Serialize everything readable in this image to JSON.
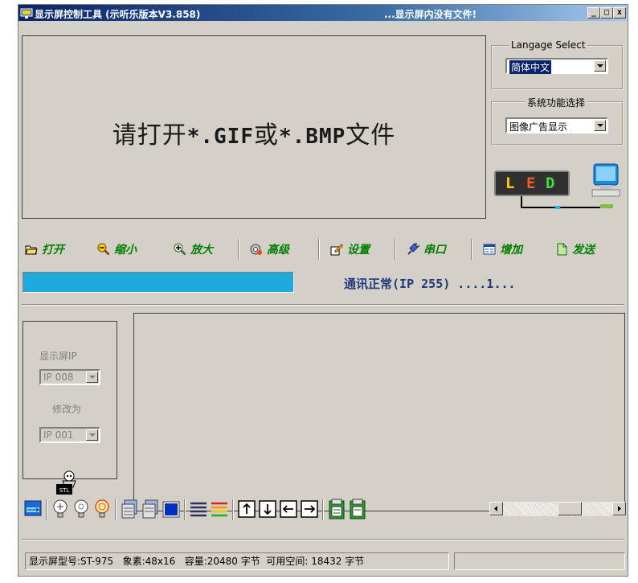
{
  "window": {
    "title": "显示屏控制工具 (示听乐版本V3.858)",
    "status_text": "...显示屏内没有文件!",
    "minimize_label": "_",
    "maximize_label": "□",
    "close_label": "x"
  },
  "preview": {
    "message_prefix": "请打开",
    "message_gif": "*.GIF",
    "message_mid": "或",
    "message_bmp": "*.BMP",
    "message_suffix": "文件"
  },
  "language_group": {
    "legend": "Langage Select",
    "selected": "简体中文"
  },
  "function_group": {
    "legend": "系统功能选择",
    "selected": "图像广告显示"
  },
  "led_logo": {
    "letters": [
      "L",
      "E",
      "D"
    ],
    "colors": [
      "#ffd400",
      "#ff5a1e",
      "#40e040"
    ]
  },
  "toolbar": {
    "open": "打开",
    "zoom_out": "缩小",
    "zoom_in": "放大",
    "advanced": "高级",
    "settings": "设置",
    "serial": "串口",
    "add": "增加",
    "send": "发送"
  },
  "progress": {
    "value": 1.0,
    "color": "#1eaadc"
  },
  "comm_status": {
    "label": "通讯正常",
    "detail": "(IP 255) ....1..."
  },
  "ip_panel": {
    "display_ip_label": "显示屏IP",
    "display_ip_value": "IP 008",
    "change_to_label": "修改为",
    "change_to_value": "IP 001"
  },
  "bottom_icons": [
    "screen-swap-icon",
    "lightbulb-outline-icon",
    "lightbulb-icon",
    "lightbulb-on-icon",
    "document-stack-icon",
    "document-stack-2-icon",
    "blue-square-icon",
    "lines-icon",
    "color-lines-icon",
    "arrow-up-box-icon",
    "arrow-down-box-icon",
    "arrow-left-box-icon",
    "arrow-right-box-icon",
    "clipboard-on-icon",
    "clipboard-off-icon"
  ],
  "statusbar": {
    "model": "显示屏型号:ST-975",
    "pixels": "象素:48x16",
    "capacity": "容量:20480 字节",
    "free": "可用空间: 18432 字节",
    "extra": ""
  },
  "colors": {
    "titlebar": "#0a246a",
    "face": "#d4d0c8",
    "toolbar_text": "#008000",
    "comm_text": "#1f3a7a"
  }
}
